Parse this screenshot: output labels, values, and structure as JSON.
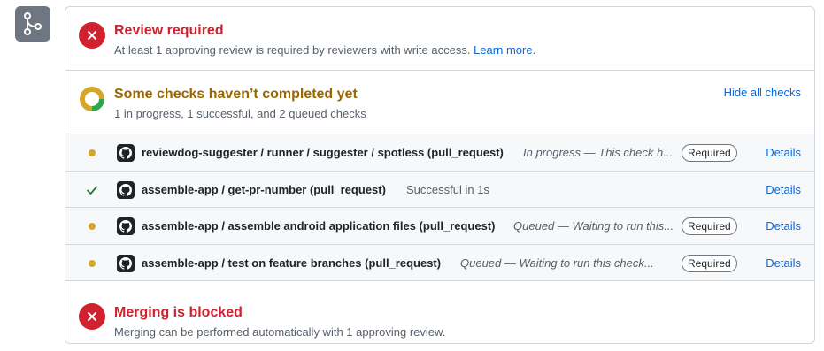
{
  "merge_icon": "git-merge-icon",
  "review": {
    "title": "Review required",
    "description": "At least 1 approving review is required by reviewers with write access.",
    "learn_more": "Learn more",
    "period": ".",
    "icon": "x-icon",
    "color": "#cf222e"
  },
  "checks": {
    "title": "Some checks haven’t completed yet",
    "summary": "1 in progress, 1 successful, and 2 queued checks",
    "hide_label": "Hide all checks",
    "title_color": "#9a6700",
    "items": [
      {
        "state": "pending",
        "name": "reviewdog-suggester / runner / suggester / spotless (pull_request)",
        "status": "In progress — This check h...",
        "required": "Required",
        "details": "Details"
      },
      {
        "state": "success",
        "name": "assemble-app / get-pr-number (pull_request)",
        "status": "Successful in 1s",
        "required": "",
        "details": "Details"
      },
      {
        "state": "queued",
        "name": "assemble-app / assemble android application files (pull_request)",
        "status": "Queued — Waiting to run this...",
        "required": "Required",
        "details": "Details"
      },
      {
        "state": "queued",
        "name": "assemble-app / test on feature branches (pull_request)",
        "status": "Queued — Waiting to run this check...",
        "required": "Required",
        "details": "Details"
      }
    ]
  },
  "merge": {
    "title": "Merging is blocked",
    "description": "Merging can be performed automatically with 1 approving review.",
    "icon": "x-icon",
    "color": "#cf222e"
  }
}
